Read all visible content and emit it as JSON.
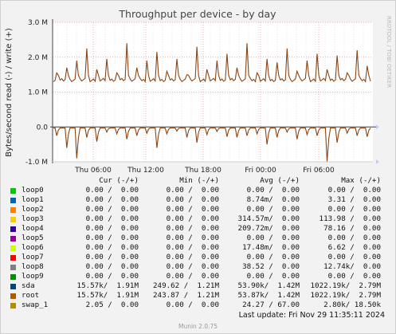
{
  "chart_data": {
    "type": "line",
    "title": "Throughput per device - by day",
    "ylabel": "Bytes/second read (-) / write (+)",
    "ylim": [
      -1000000,
      3000000
    ],
    "y_ticks": [
      {
        "value": 3000000,
        "label": "3.0 M"
      },
      {
        "value": 2000000,
        "label": "2.0 M"
      },
      {
        "value": 1000000,
        "label": "1.0 M"
      },
      {
        "value": 0,
        "label": "0.0"
      },
      {
        "value": -1000000,
        "label": "-1.0 M"
      }
    ],
    "x_ticks": [
      "Thu 06:00",
      "Thu 12:00",
      "Thu 18:00",
      "Fri 00:00",
      "Fri 06:00"
    ],
    "grid": true,
    "series": [
      {
        "name": "root",
        "color": "#8b4513",
        "direction": "write (+)",
        "baseline": 1300000,
        "spike_peaks": [
          1550000,
          1700000,
          1900000,
          2250000,
          1650000,
          1950000,
          1550000,
          2400000,
          1700000,
          1900000,
          2150000,
          1600000,
          1950000,
          1500000,
          2300000,
          1650000,
          1900000,
          2100000,
          1700000,
          2400000,
          1550000,
          1950000,
          1850000,
          2250000,
          1600000,
          1900000,
          2100000,
          1650000,
          2050000,
          1550000,
          2200000,
          1750000
        ]
      },
      {
        "name": "root",
        "color": "#8b4513",
        "direction": "read (-)",
        "baseline": -30000,
        "spike_peaks": [
          -250000,
          -600000,
          -900000,
          -300000,
          -420000,
          -150000,
          -200000,
          -350000,
          -250000,
          -180000,
          -600000,
          -200000,
          -120000,
          -300000,
          -450000,
          -220000,
          -130000,
          -280000,
          -300000,
          -250000,
          -200000,
          -500000,
          -300000,
          -150000,
          -350000,
          -220000,
          -250000,
          -1000000,
          -450000,
          -180000,
          -250000,
          -280000
        ]
      }
    ]
  },
  "chart_colors": {
    "grid": "#f0a8a8",
    "axis": "#444444",
    "plot_bg": "#ffffff",
    "tick_text": "#222222",
    "arrow": "#c8c8ff"
  },
  "watermark": "RRDTOOL / TOBI OETIKER",
  "legend": {
    "header": {
      "cur": "Cur (-/+)",
      "min": "Min (-/+)",
      "avg": "Avg (-/+)",
      "max": "Max (-/+)"
    },
    "rows": [
      {
        "name": "loop0",
        "color": "#00cc00",
        "cur": "0.00 /  0.00",
        "min": "0.00 /  0.00",
        "avg": "0.00 /  0.00",
        "max": "0.00 /  0.00"
      },
      {
        "name": "loop1",
        "color": "#0066b3",
        "cur": "0.00 /  0.00",
        "min": "0.00 /  0.00",
        "avg": "8.74m/  0.00",
        "max": "3.31 /  0.00"
      },
      {
        "name": "loop2",
        "color": "#ff8000",
        "cur": "0.00 /  0.00",
        "min": "0.00 /  0.00",
        "avg": "0.00 /  0.00",
        "max": "0.00 /  0.00"
      },
      {
        "name": "loop3",
        "color": "#ffcc00",
        "cur": "0.00 /  0.00",
        "min": "0.00 /  0.00",
        "avg": "314.57m/  0.00",
        "max": "113.98 /  0.00"
      },
      {
        "name": "loop4",
        "color": "#330099",
        "cur": "0.00 /  0.00",
        "min": "0.00 /  0.00",
        "avg": "209.72m/  0.00",
        "max": "78.16 /  0.00"
      },
      {
        "name": "loop5",
        "color": "#990099",
        "cur": "0.00 /  0.00",
        "min": "0.00 /  0.00",
        "avg": "0.00 /  0.00",
        "max": "0.00 /  0.00"
      },
      {
        "name": "loop6",
        "color": "#ccff00",
        "cur": "0.00 /  0.00",
        "min": "0.00 /  0.00",
        "avg": "17.48m/  0.00",
        "max": "6.62 /  0.00"
      },
      {
        "name": "loop7",
        "color": "#ff0000",
        "cur": "0.00 /  0.00",
        "min": "0.00 /  0.00",
        "avg": "0.00 /  0.00",
        "max": "0.00 /  0.00"
      },
      {
        "name": "loop8",
        "color": "#808080",
        "cur": "0.00 /  0.00",
        "min": "0.00 /  0.00",
        "avg": "38.52 /  0.00",
        "max": "12.74k/  0.00"
      },
      {
        "name": "loop9",
        "color": "#008f00",
        "cur": "0.00 /  0.00",
        "min": "0.00 /  0.00",
        "avg": "0.00 /  0.00",
        "max": "0.00 /  0.00"
      },
      {
        "name": "sda",
        "color": "#00487d",
        "cur": "15.57k/  1.91M",
        "min": "249.62 /  1.21M",
        "avg": "53.90k/  1.42M",
        "max": "1022.19k/  2.79M"
      },
      {
        "name": "root",
        "color": "#b35a00",
        "cur": "15.57k/  1.91M",
        "min": "243.87 /  1.21M",
        "avg": "53.87k/  1.42M",
        "max": "1022.19k/  2.79M"
      },
      {
        "name": "swap_1",
        "color": "#b38f00",
        "cur": "2.05 /  0.00",
        "min": "0.00 /  0.00",
        "avg": "24.27 / 67.00",
        "max": "2.80k/ 18.50k"
      }
    ]
  },
  "footer": {
    "last_update": "Last update: Fri Nov 29 11:35:11 2024",
    "version": "Munin 2.0.75"
  }
}
